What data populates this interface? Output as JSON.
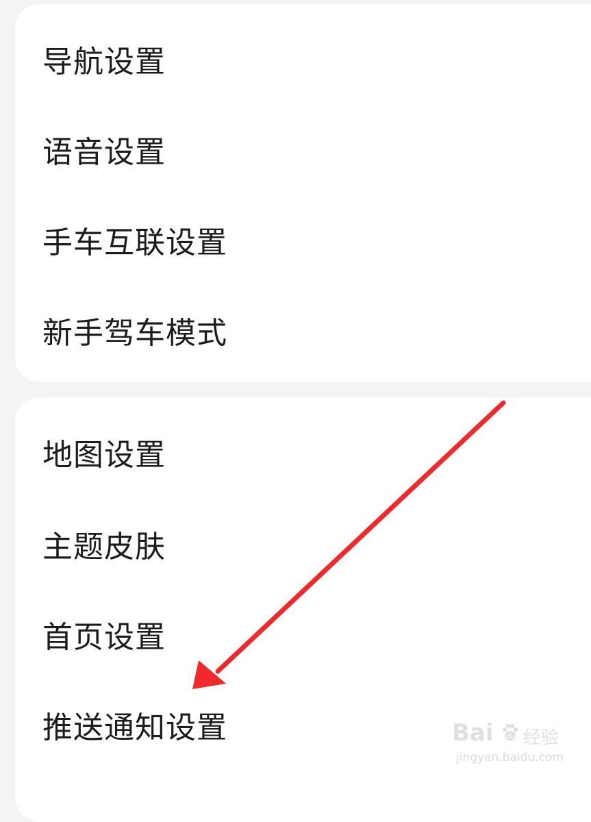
{
  "groups": [
    {
      "items": [
        {
          "label": "导航设置"
        },
        {
          "label": "语音设置"
        },
        {
          "label": "手车互联设置"
        },
        {
          "label": "新手驾车模式"
        }
      ]
    },
    {
      "items": [
        {
          "label": "地图设置"
        },
        {
          "label": "主题皮肤"
        },
        {
          "label": "首页设置"
        },
        {
          "label": "推送通知设置"
        }
      ]
    }
  ],
  "annotation": {
    "arrow_color": "#f02a2a"
  },
  "watermark": {
    "brand": "Bai",
    "suffix": "经验",
    "domain": "jingyan.baidu.com"
  },
  "colors": {
    "background": "#f3f4f6",
    "card": "#ffffff",
    "text": "#1c1c1c"
  }
}
